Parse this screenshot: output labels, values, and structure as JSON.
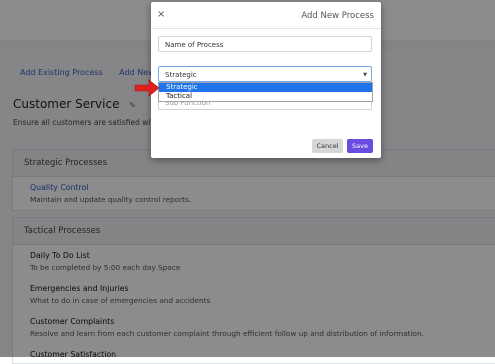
{
  "background": {
    "nav_links": [
      "Add Existing Process",
      "Add New Pr"
    ],
    "page_title": "Customer Service",
    "page_description": "Ensure all customers are satisfied with",
    "sections": [
      {
        "heading": "Strategic Processes",
        "items": [
          {
            "title": "Quality Control",
            "description": "Maintain and update quality control reports."
          }
        ]
      },
      {
        "heading": "Tactical Processes",
        "items": [
          {
            "title": "Daily To Do List",
            "description": "To be completed by 5:00 each day Space"
          },
          {
            "title": "Emergencies and Injuries",
            "description": "What to do in case of emergencies and accidents"
          },
          {
            "title": "Customer Complaints",
            "description": "Resolve and learn from each customer complaint through efficient follow up and distribution of information."
          },
          {
            "title": "Customer Satisfaction",
            "description": ""
          }
        ]
      }
    ]
  },
  "modal": {
    "close_glyph": "×",
    "title": "Add New Process",
    "name_placeholder": "Name of Process",
    "select_value": "Strategic",
    "options": [
      "Strategic",
      "Tactical"
    ],
    "sub_function_placeholder": "Sub Function",
    "cancel_label": "Cancel",
    "save_label": "Save"
  },
  "colors": {
    "accent": "#6a4ce0",
    "link": "#2a55c7",
    "highlight": "#1e74e8",
    "arrow": "#e02020"
  }
}
